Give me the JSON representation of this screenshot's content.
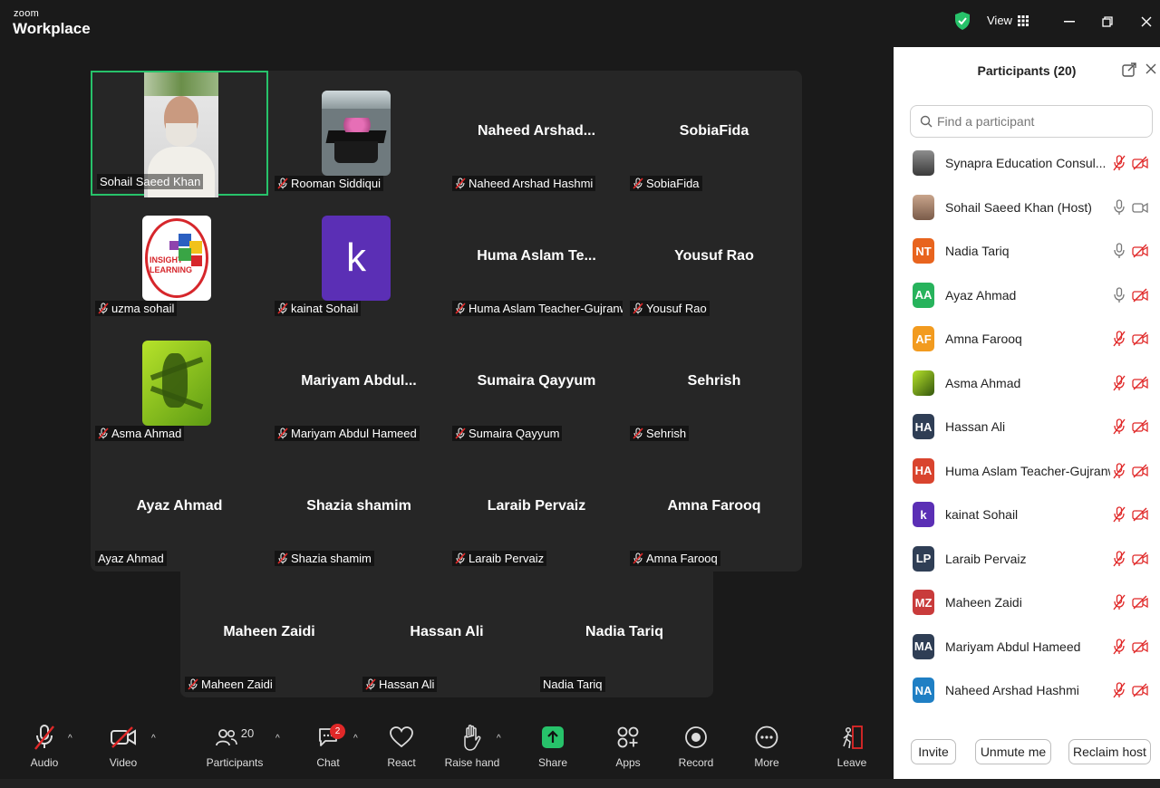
{
  "app": {
    "brand_small": "zoom",
    "brand": "Workplace",
    "view_label": "View"
  },
  "tiles": [
    {
      "id": "sohail",
      "label": "Sohail Saeed Khan",
      "big": "",
      "muted": false,
      "img": "video",
      "active": true
    },
    {
      "id": "rooman",
      "label": "Rooman Siddiqui",
      "big": "",
      "muted": true,
      "img": "cap"
    },
    {
      "id": "naheed",
      "label": "Naheed Arshad Hashmi",
      "big": "Naheed  Arshad...",
      "muted": true
    },
    {
      "id": "sobia",
      "label": "SobiaFida",
      "big": "SobiaFida",
      "muted": true
    },
    {
      "id": "uzma",
      "label": "uzma sohail",
      "big": "",
      "muted": true,
      "img": "insight"
    },
    {
      "id": "kainat",
      "label": "kainat Sohail",
      "big": "",
      "muted": true,
      "img": "k"
    },
    {
      "id": "huma",
      "label": "Huma Aslam Teacher-Gujranw...",
      "big": "Huma Aslam  Te...",
      "muted": true
    },
    {
      "id": "yousuf",
      "label": "Yousuf Rao",
      "big": "Yousuf Rao",
      "muted": true
    },
    {
      "id": "asma",
      "label": "Asma Ahmad",
      "big": "",
      "muted": true,
      "img": "frog"
    },
    {
      "id": "mariyam",
      "label": "Mariyam Abdul Hameed",
      "big": "Mariyam  Abdul...",
      "muted": true
    },
    {
      "id": "sumaira",
      "label": "Sumaira Qayyum",
      "big": "Sumaira Qayyum",
      "muted": true
    },
    {
      "id": "sehrish",
      "label": "Sehrish",
      "big": "Sehrish",
      "muted": true
    },
    {
      "id": "ayaz",
      "label": "Ayaz Ahmad",
      "big": "Ayaz Ahmad",
      "muted": false
    },
    {
      "id": "shazia",
      "label": "Shazia shamim",
      "big": "Shazia shamim",
      "muted": true
    },
    {
      "id": "laraib",
      "label": "Laraib Pervaiz",
      "big": "Laraib Pervaiz",
      "muted": true
    },
    {
      "id": "amna",
      "label": "Amna Farooq",
      "big": "Amna Farooq",
      "muted": true
    },
    {
      "id": "maheen",
      "label": "Maheen Zaidi",
      "big": "Maheen Zaidi",
      "muted": true
    },
    {
      "id": "hassan",
      "label": "Hassan Ali",
      "big": "Hassan Ali",
      "muted": true
    },
    {
      "id": "nadia",
      "label": "Nadia Tariq",
      "big": "Nadia Tariq",
      "muted": false
    }
  ],
  "toolbar": {
    "audio": "Audio",
    "video": "Video",
    "participants": "Participants",
    "participants_count": "20",
    "chat": "Chat",
    "chat_badge": "2",
    "react": "React",
    "raise_hand": "Raise hand",
    "share": "Share",
    "apps": "Apps",
    "record": "Record",
    "more": "More",
    "leave": "Leave"
  },
  "panel": {
    "title": "Participants (20)",
    "search_placeholder": "Find a participant",
    "participants": [
      {
        "initials": "",
        "name": "Synapra Education Consul... (Me)",
        "color": "#888888",
        "mic": "muted",
        "cam": "off",
        "img": "photo"
      },
      {
        "initials": "",
        "name": "Sohail Saeed Khan (Host)",
        "color": "#888888",
        "mic": "on",
        "cam": "on",
        "img": "photo2"
      },
      {
        "initials": "NT",
        "name": "Nadia Tariq",
        "color": "#e8641e",
        "mic": "on",
        "cam": "off"
      },
      {
        "initials": "AA",
        "name": "Ayaz Ahmad",
        "color": "#27b35c",
        "mic": "on",
        "cam": "off"
      },
      {
        "initials": "AF",
        "name": "Amna Farooq",
        "color": "#f29b1f",
        "mic": "muted",
        "cam": "off"
      },
      {
        "initials": "",
        "name": "Asma Ahmad",
        "color": "#7fc424",
        "mic": "muted",
        "cam": "off",
        "img": "frog"
      },
      {
        "initials": "HA",
        "name": "Hassan Ali",
        "color": "#2f3e55",
        "mic": "muted",
        "cam": "off"
      },
      {
        "initials": "HA",
        "name": "Huma Aslam Teacher-Gujranwa...",
        "color": "#d9442e",
        "mic": "muted",
        "cam": "off"
      },
      {
        "initials": "k",
        "name": "kainat Sohail",
        "color": "#5b2fb5",
        "mic": "muted",
        "cam": "off"
      },
      {
        "initials": "LP",
        "name": "Laraib Pervaiz",
        "color": "#2f3e55",
        "mic": "muted",
        "cam": "off"
      },
      {
        "initials": "MZ",
        "name": "Maheen Zaidi",
        "color": "#c93b3b",
        "mic": "muted",
        "cam": "off"
      },
      {
        "initials": "MA",
        "name": "Mariyam Abdul Hameed",
        "color": "#2f3e55",
        "mic": "muted",
        "cam": "off"
      },
      {
        "initials": "NA",
        "name": "Naheed Arshad Hashmi",
        "color": "#1f7fc4",
        "mic": "muted",
        "cam": "off"
      }
    ],
    "invite": "Invite",
    "unmute_me": "Unmute me",
    "reclaim_host": "Reclaim host"
  },
  "colors": {
    "active_border": "#27c26a",
    "muted_red": "#e02828",
    "share_green": "#27c26a"
  }
}
